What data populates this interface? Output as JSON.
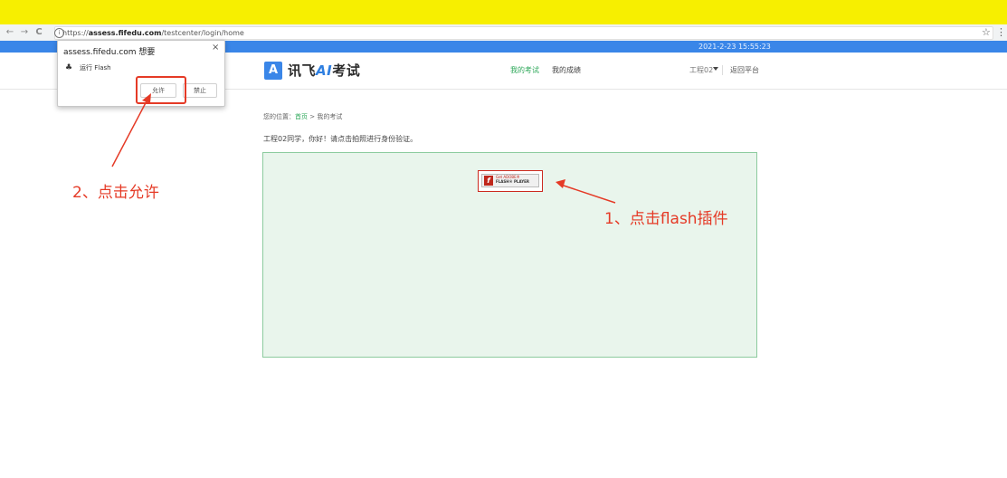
{
  "browser": {
    "url_prefix": "https://",
    "url_domain": "assess.fifedu.com",
    "url_path": "/testcenter/login/home",
    "back_icon": "←",
    "forward_icon": "→",
    "reload_icon": "C",
    "info_icon": "i",
    "star_icon": "☆",
    "menu_icon": "⋮"
  },
  "topbar": {
    "datetime": "2021-2-23 15:55:23"
  },
  "header": {
    "logo_glyph": "A",
    "logo_prefix": "讯飞",
    "logo_ai": "AI",
    "logo_suffix": "考试",
    "nav": [
      "我的考试",
      "我的成绩"
    ],
    "user": "工程02",
    "back_label": "返回平台"
  },
  "breadcrumb": {
    "prefix": "您的位置：",
    "home": "首页",
    "sep": " > ",
    "current": "我的考试"
  },
  "greeting": "工程02同学，你好！请点击拍照进行身份验证。",
  "flash": {
    "logo": "f",
    "get_text": "Get ADOBE®",
    "player_text": "FLASH® PLAYER"
  },
  "popup": {
    "title": "assess.fifedu.com 想要",
    "close": "×",
    "permission_icon": "♣",
    "permission": "运行 Flash",
    "allow": "允许",
    "block": "禁止"
  },
  "annotations": {
    "step2": "2、点击允许",
    "step1": "1、点击flash插件",
    "color": "#e53a26"
  },
  "colors": {
    "accent_green": "#2ea85a",
    "brand_blue": "#3a86e8",
    "top_yellow": "#f7ef00"
  }
}
